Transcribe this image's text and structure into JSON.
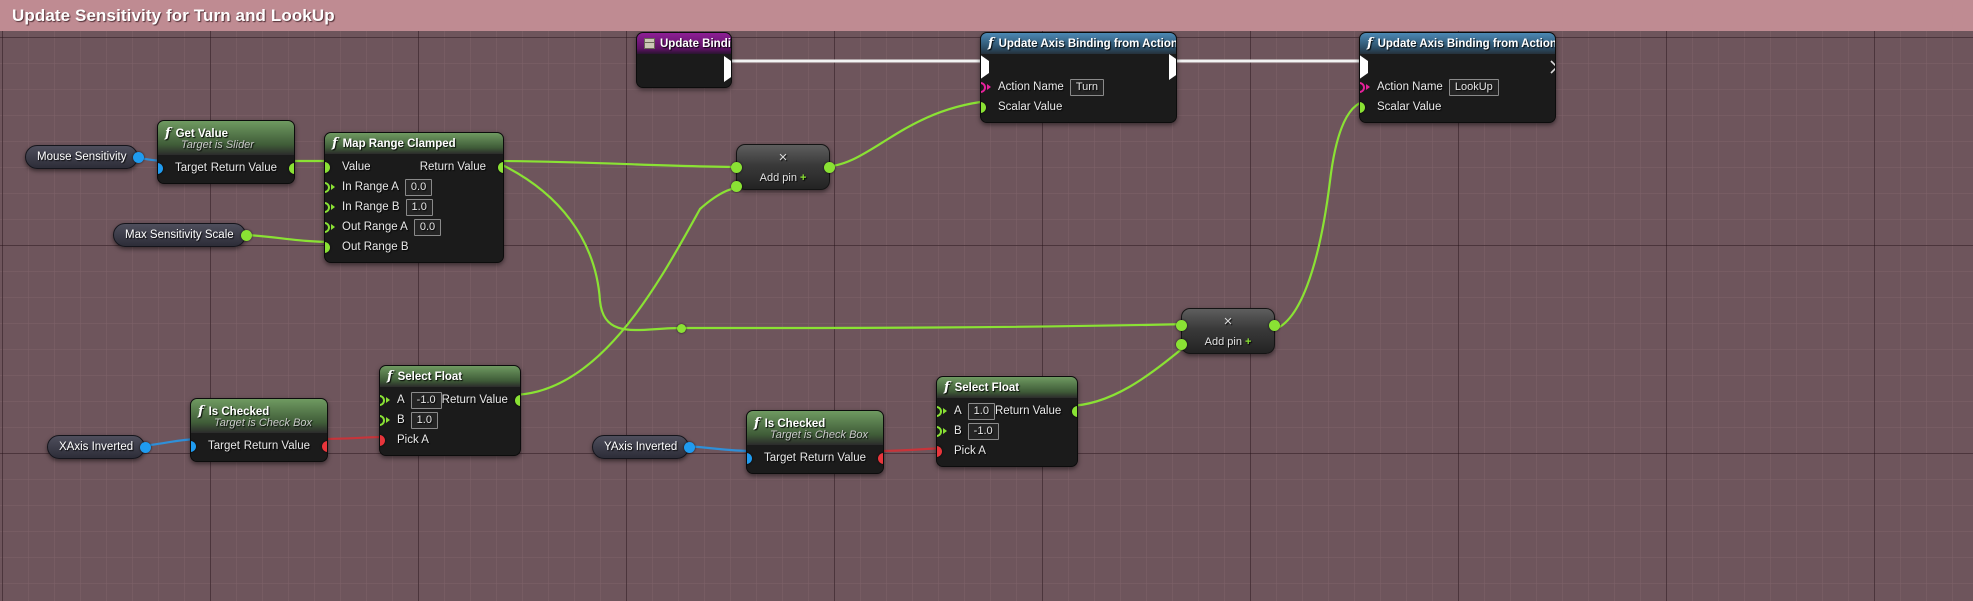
{
  "window": {
    "title": "Update Sensitivity for Turn and LookUp"
  },
  "graph": {
    "event_node": {
      "title": "Update Bindings",
      "icon": "event-icon"
    },
    "nodes": [
      {
        "id": "get-value",
        "title": "Get Value",
        "subtitle": "Target is Slider",
        "inputs": [
          {
            "label": "Target"
          }
        ],
        "outputs": [
          {
            "label": "Return Value"
          }
        ]
      },
      {
        "id": "map-range-clamped",
        "title": "Map Range Clamped",
        "inputs": [
          {
            "label": "Value",
            "value": ""
          },
          {
            "label": "In Range A",
            "value": "0.0"
          },
          {
            "label": "In Range B",
            "value": "1.0"
          },
          {
            "label": "Out Range A",
            "value": "0.0"
          },
          {
            "label": "Out Range B",
            "value": ""
          }
        ],
        "outputs": [
          {
            "label": "Return Value"
          }
        ]
      },
      {
        "id": "update-axis-binding-turn",
        "title": "Update Axis Binding from Action Name",
        "inputs": [
          {
            "label": "Action Name",
            "value": "Turn"
          },
          {
            "label": "Scalar Value",
            "value": ""
          }
        ]
      },
      {
        "id": "update-axis-binding-lookup",
        "title": "Update Axis Binding from Action Name",
        "inputs": [
          {
            "label": "Action Name",
            "value": "LookUp"
          },
          {
            "label": "Scalar Value",
            "value": ""
          }
        ]
      },
      {
        "id": "select-float-x",
        "title": "Select Float",
        "inputs": [
          {
            "label": "A",
            "value": "-1.0"
          },
          {
            "label": "B",
            "value": "1.0"
          },
          {
            "label": "Pick A",
            "value": ""
          }
        ],
        "outputs": [
          {
            "label": "Return Value"
          }
        ]
      },
      {
        "id": "select-float-y",
        "title": "Select Float",
        "inputs": [
          {
            "label": "A",
            "value": "1.0"
          },
          {
            "label": "B",
            "value": "-1.0"
          },
          {
            "label": "Pick A",
            "value": ""
          }
        ],
        "outputs": [
          {
            "label": "Return Value"
          }
        ]
      },
      {
        "id": "is-checked-x",
        "title": "Is Checked",
        "subtitle": "Target is Check Box",
        "inputs": [
          {
            "label": "Target"
          }
        ],
        "outputs": [
          {
            "label": "Return Value"
          }
        ]
      },
      {
        "id": "is-checked-y",
        "title": "Is Checked",
        "subtitle": "Target is Check Box",
        "inputs": [
          {
            "label": "Target"
          }
        ],
        "outputs": [
          {
            "label": "Return Value"
          }
        ]
      }
    ],
    "variables": [
      {
        "id": "mouse-sensitivity",
        "label": "Mouse Sensitivity"
      },
      {
        "id": "max-sensitivity-scale",
        "label": "Max Sensitivity Scale"
      },
      {
        "id": "xaxis-inverted",
        "label": "XAxis Inverted"
      },
      {
        "id": "yaxis-inverted",
        "label": "YAxis Inverted"
      }
    ],
    "multiply_nodes": [
      {
        "id": "multiply-turn",
        "glyph": "×",
        "add_pin_label": "Add pin",
        "plus": "+"
      },
      {
        "id": "multiply-lookup",
        "glyph": "×",
        "add_pin_label": "Add pin",
        "plus": "+"
      }
    ],
    "colors": {
      "exec_wire": "#f2f2f2",
      "float_wire": "#8ae234",
      "bool_wire": "#c8343a",
      "object_wire": "#1f9bf0",
      "name_pin": "#e6219b",
      "title_bar": "#bf8b92",
      "canvas": "#6e555c"
    }
  }
}
